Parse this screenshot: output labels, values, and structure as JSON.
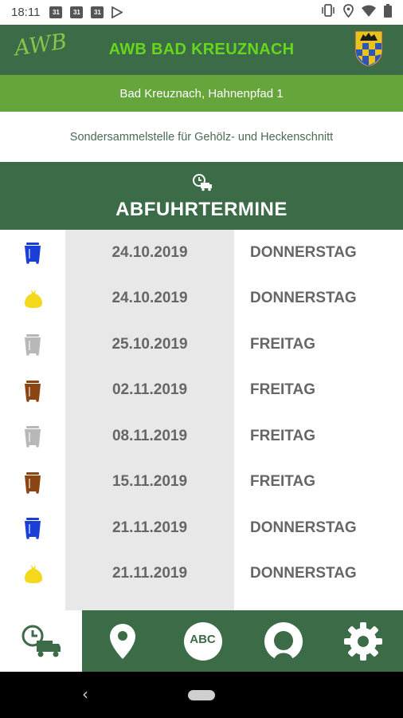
{
  "status_bar": {
    "time": "18:11",
    "cal_day": "31",
    "icons": [
      "calendar-icon",
      "calendar-icon",
      "calendar-icon",
      "play-store-icon",
      "vibrate-icon",
      "location-icon",
      "wifi-icon",
      "battery-icon"
    ]
  },
  "header": {
    "logo_text": "AWB",
    "title": "AWB BAD KREUZNACH",
    "crest_icon": "coat-of-arms-icon"
  },
  "address": "Bad Kreuznach, Hahnenpfad 1",
  "subtitle": "Sondersammelstelle für Gehölz- und Heckenschnitt",
  "section": {
    "icon": "clock-truck-icon",
    "title": "ABFUHRTERMINE"
  },
  "colors": {
    "dark_green": "#3c6b47",
    "light_green": "#66a53c",
    "title_green": "#66d61e",
    "blue_bin": "#1a3fd6",
    "yellow_bag": "#f3d81b",
    "grey_bin": "#b8b8b8",
    "brown_bin": "#8b4513"
  },
  "pickups": [
    {
      "bin": "blue-bin-icon",
      "color": "#1a3fd6",
      "date": "24.10.2019",
      "day": "DONNERSTAG"
    },
    {
      "bin": "yellow-bag-icon",
      "color": "#f3d81b",
      "date": "24.10.2019",
      "day": "DONNERSTAG"
    },
    {
      "bin": "grey-bin-icon",
      "color": "#b8b8b8",
      "date": "25.10.2019",
      "day": "FREITAG"
    },
    {
      "bin": "brown-bin-icon",
      "color": "#8b4513",
      "date": "02.11.2019",
      "day": "FREITAG"
    },
    {
      "bin": "grey-bin-icon",
      "color": "#b8b8b8",
      "date": "08.11.2019",
      "day": "FREITAG"
    },
    {
      "bin": "brown-bin-icon",
      "color": "#8b4513",
      "date": "15.11.2019",
      "day": "FREITAG"
    },
    {
      "bin": "blue-bin-icon",
      "color": "#1a3fd6",
      "date": "21.11.2019",
      "day": "DONNERSTAG"
    },
    {
      "bin": "yellow-bag-icon",
      "color": "#f3d81b",
      "date": "21.11.2019",
      "day": "DONNERSTAG"
    }
  ],
  "bottom_nav": {
    "abc_label": "ABC",
    "items": [
      "schedule",
      "location",
      "abc",
      "profile",
      "settings"
    ],
    "active": "schedule"
  }
}
